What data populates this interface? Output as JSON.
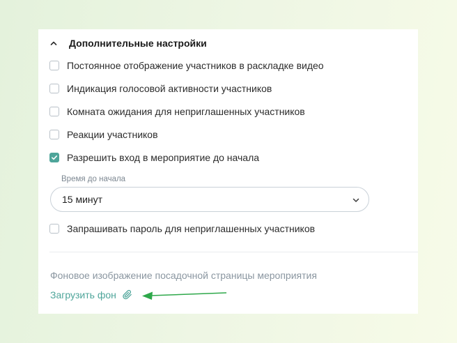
{
  "section": {
    "title": "Дополнительные настройки",
    "collapse_icon": "chevron-up-icon"
  },
  "options": [
    {
      "label": "Постоянное отображение участников в раскладке видео",
      "checked": false
    },
    {
      "label": "Индикация голосовой активности участников",
      "checked": false
    },
    {
      "label": "Комната ожидания для неприглашенных участников",
      "checked": false
    },
    {
      "label": "Реакции участников",
      "checked": false
    },
    {
      "label": "Разрешить вход в мероприятие до начала",
      "checked": true
    }
  ],
  "time_before_start": {
    "caption": "Время до начала",
    "value": "15 минут",
    "dropdown_icon": "chevron-down-icon"
  },
  "password_option": {
    "label": "Запрашивать пароль для неприглашенных участников",
    "checked": false
  },
  "background": {
    "label": "Фоновое изображение посадочной страницы мероприятия",
    "upload_label": "Загрузить фон",
    "upload_icon": "paperclip-icon"
  },
  "colors": {
    "accent": "#4ea59a",
    "annotation_arrow": "#2ea84a"
  }
}
